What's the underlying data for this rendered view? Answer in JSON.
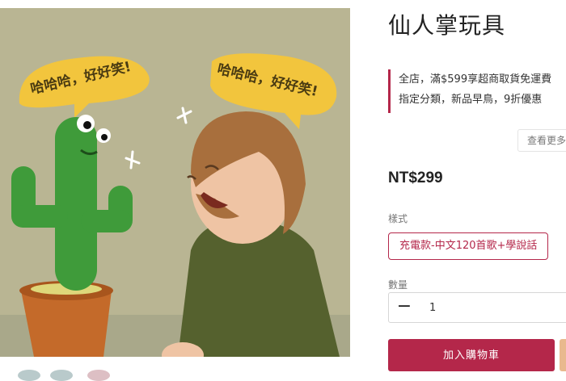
{
  "product": {
    "title": "仙人掌玩具",
    "promo_lines": [
      "全店，滿$599享超商取貨免運費",
      "指定分類，新品早鳥，9折優惠"
    ],
    "more_label": "查看更多",
    "price": "NT$299",
    "style_label": "樣式",
    "style_option": "充電款-中文120首歌+學說話",
    "quantity_label": "數量",
    "quantity_value": "1",
    "add_to_cart_label": "加入購物車"
  },
  "image": {
    "bubble_left": "哈哈哈，好好笑!",
    "bubble_right": "哈哈哈，好好笑!"
  },
  "colors": {
    "accent": "#b4274a",
    "secondary_button": "#e9b98e",
    "bubble": "#f2c53d"
  }
}
